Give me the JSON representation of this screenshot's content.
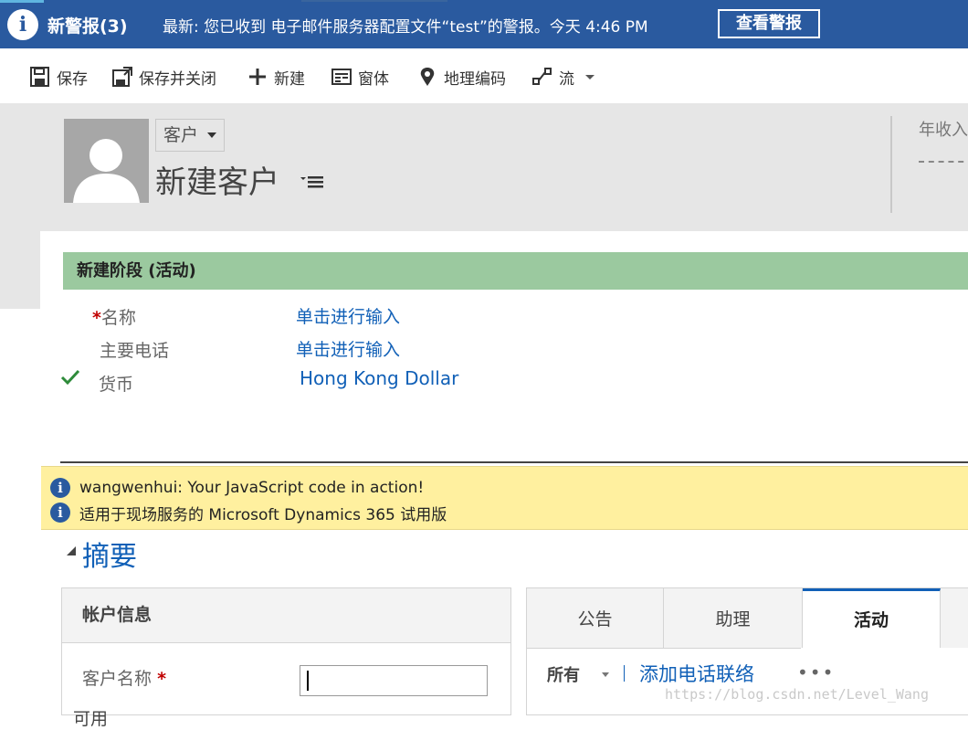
{
  "alert": {
    "count_label": "新警报(3)",
    "message": "最新: 您已收到 电子邮件服务器配置文件“test”的警报。今天 4:46 PM",
    "button": "查看警报",
    "icon": "info-icon"
  },
  "toolbar": {
    "save": "保存",
    "save_close": "保存并关闭",
    "new": "新建",
    "form": "窗体",
    "geocode": "地理编码",
    "flow": "流"
  },
  "header": {
    "entity": "客户",
    "title": "新建客户",
    "annual_label": "年收入",
    "annual_value": "---"
  },
  "stage": {
    "title": "新建阶段 (活动)",
    "fields": [
      {
        "label": "名称",
        "value": "单击进行输入",
        "required": true
      },
      {
        "label": "主要电话",
        "value": "单击进行输入",
        "required": false
      },
      {
        "label": "货币",
        "value": "Hong Kong Dollar",
        "required": false,
        "completed": true
      }
    ]
  },
  "notifications": [
    "wangwenhui: Your JavaScript code in action!",
    "适用于现场服务的 Microsoft Dynamics 365 试用版"
  ],
  "summary": {
    "title": "摘要",
    "account_info": {
      "heading": "帐户信息",
      "name_label": "客户名称",
      "name_value": "",
      "next_label": "可用"
    },
    "tabs": [
      {
        "label": "公告",
        "active": false
      },
      {
        "label": "助理",
        "active": false
      },
      {
        "label": "活动",
        "active": true
      }
    ],
    "filter": "所有",
    "add_call": "添加电话联络",
    "more": "•••"
  },
  "watermark": "https://blog.csdn.net/Level_Wang",
  "colors": {
    "alert_bar": "#2a5a9f",
    "stage_bar": "#9bc99f",
    "link": "#1160b7",
    "notification_bg": "#fff09f"
  }
}
